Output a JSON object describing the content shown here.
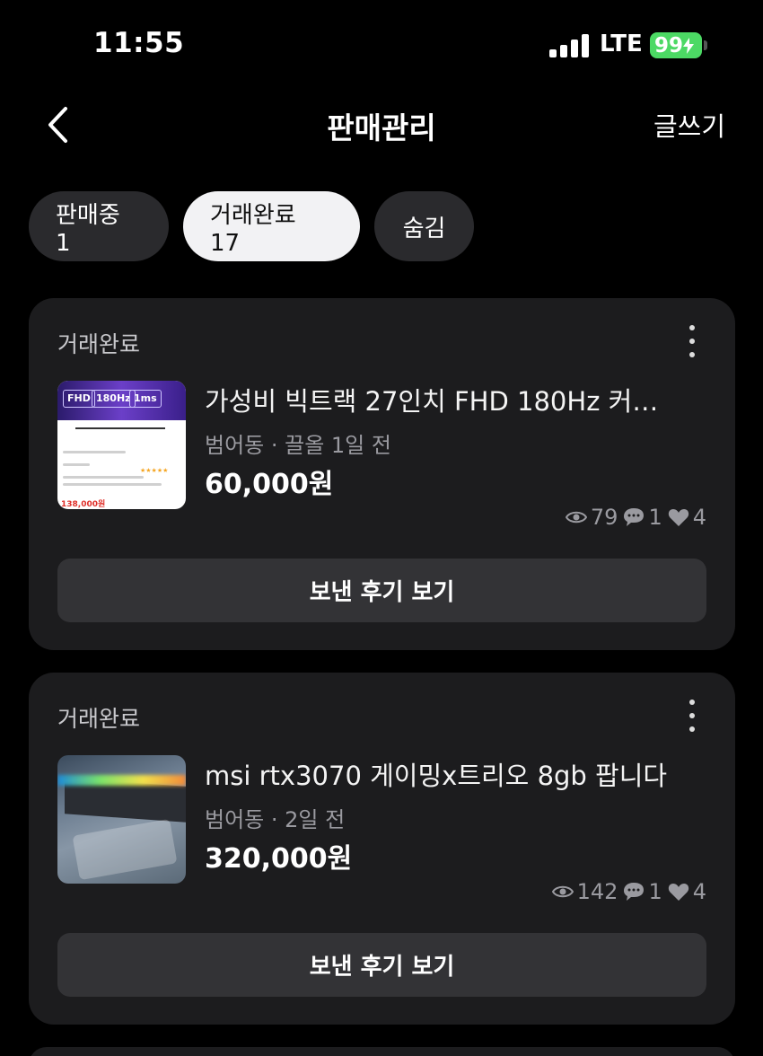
{
  "status_bar": {
    "time": "11:55",
    "network": "LTE",
    "battery": "99"
  },
  "nav": {
    "title": "판매관리",
    "write_label": "글쓰기"
  },
  "tabs": [
    {
      "label": "판매중 1",
      "active": false
    },
    {
      "label": "거래완료 17",
      "active": true
    },
    {
      "label": "숨김",
      "active": false
    }
  ],
  "items": [
    {
      "status": "거래완료",
      "title": "가성비 빅트랙 27인치 FHD 180Hz 커…",
      "meta": "범어동 · 끌올 1일 전",
      "price": "60,000원",
      "views": "79",
      "chats": "1",
      "likes": "4",
      "button_label": "보낸 후기 보기",
      "thumb_text": {
        "chip1": "FHD",
        "chip2": "180Hz",
        "chip3": "1ms",
        "price": "138,000원"
      }
    },
    {
      "status": "거래완료",
      "title": "msi rtx3070 게이밍x트리오 8gb 팝니다",
      "meta": "범어동 · 2일 전",
      "price": "320,000원",
      "views": "142",
      "chats": "1",
      "likes": "4",
      "button_label": "보낸 후기 보기"
    }
  ],
  "colors": {
    "background": "#000000",
    "card": "#1c1c1e",
    "button": "#333336",
    "battery": "#4cd964",
    "active_tab": "#f2f2f4"
  }
}
